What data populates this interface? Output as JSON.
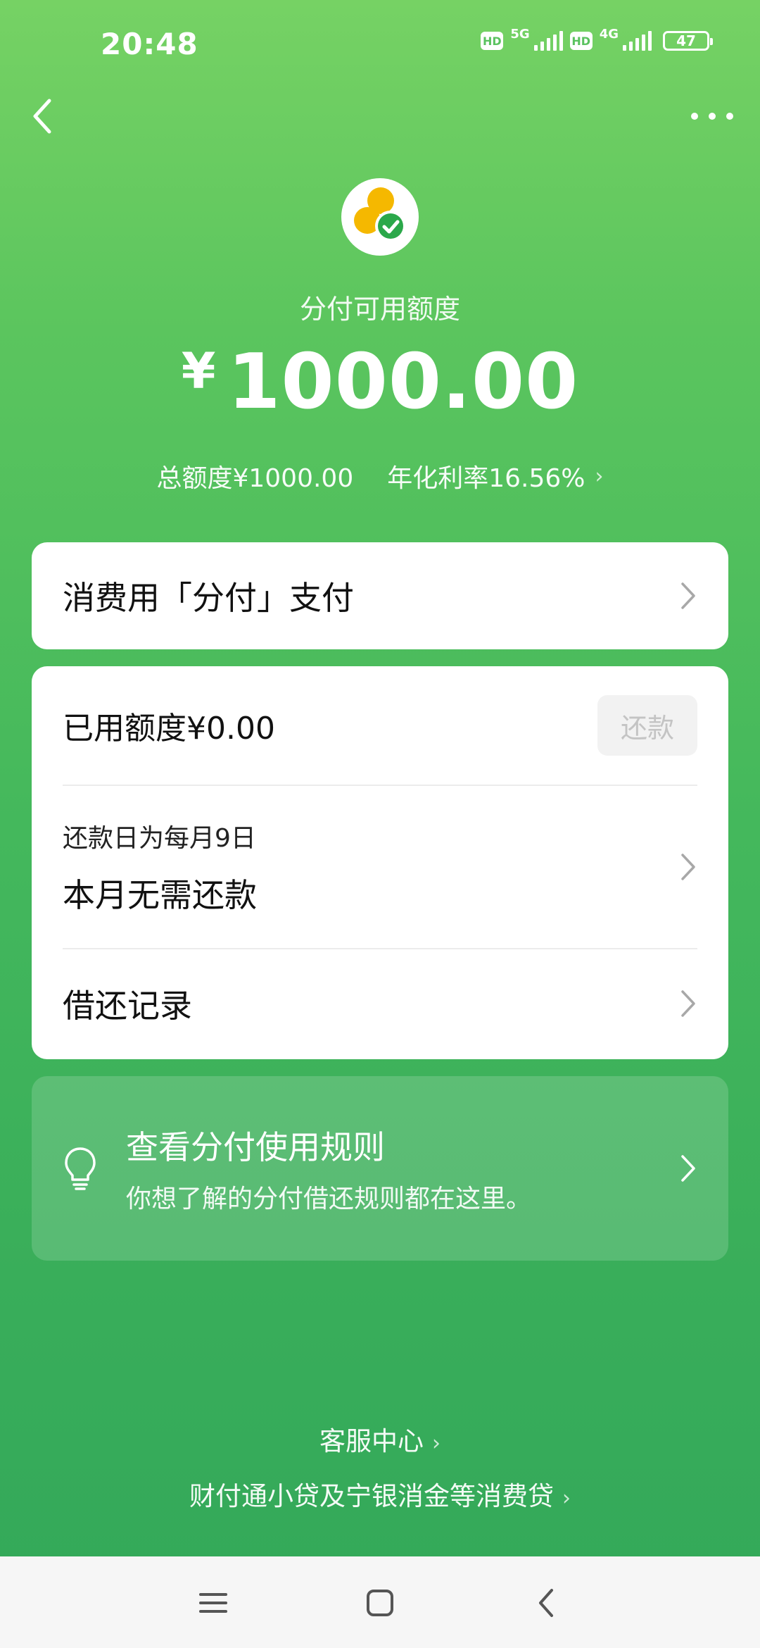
{
  "status_bar": {
    "time": "20:48",
    "hd1": "HD",
    "net1": "5G",
    "hd2": "HD",
    "net2": "4G",
    "battery": "47"
  },
  "header": {
    "back_icon": "back-arrow-icon",
    "more_icon": "more-dots-icon"
  },
  "hero": {
    "label": "分付可用额度",
    "currency": "¥",
    "amount": "1000.00",
    "total_limit": "总额度¥1000.00",
    "annual_rate": "年化利率16.56%"
  },
  "pay_card": {
    "title": "消费用「分付」支付"
  },
  "main_card": {
    "used_limit": "已用额度¥0.00",
    "repay_button": "还款",
    "due_day": "还款日为每月9日",
    "due_status": "本月无需还款",
    "history": "借还记录"
  },
  "rules_card": {
    "title": "查看分付使用规则",
    "subtitle": "你想了解的分付借还规则都在这里。"
  },
  "footer": {
    "service_center": "客服中心",
    "loan_info": "财付通小贷及宁银消金等消费贷"
  },
  "colors": {
    "brand_green": "#5bc55e",
    "logo_yellow": "#f5b800",
    "check_green": "#2ba84a"
  }
}
